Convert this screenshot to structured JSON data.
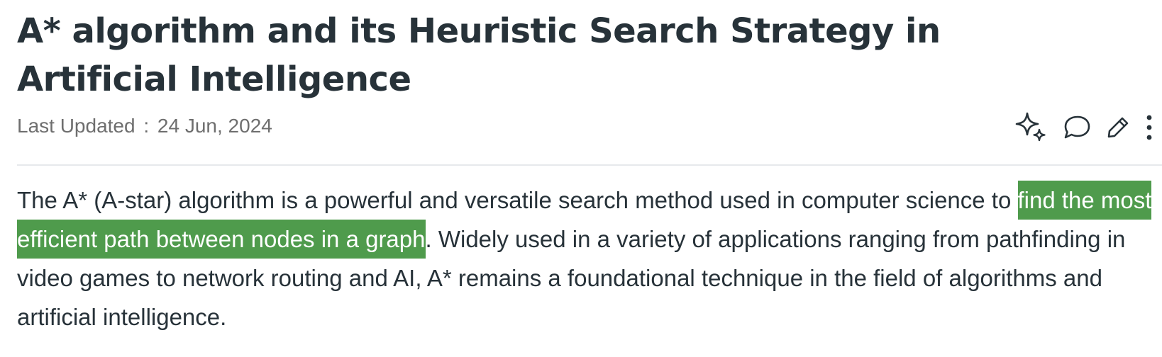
{
  "article": {
    "title": "A* algorithm and its Heuristic Search Strategy in Artificial Intelligence",
    "last_updated_label": "Last Updated",
    "separator": ":",
    "last_updated_date": "24 Jun, 2024",
    "paragraph": {
      "before": "The A* (A-star) algorithm is a powerful and versatile search method used in computer science to ",
      "highlighted": "find the most efficient path between nodes in a graph",
      "after": ". Widely used in a variety of applications ranging from pathfinding in video games to network routing and AI, A* remains a foundational technique in the field of algorithms and artificial intelligence."
    },
    "highlight_color": "#4f9b4c"
  },
  "toolbar": {
    "icons": [
      "sparkle-icon",
      "comment-icon",
      "edit-icon",
      "more-vertical-icon"
    ]
  },
  "colors": {
    "title": "#273239",
    "meta": "#6e6e6e",
    "divider": "#e7e9ec"
  }
}
